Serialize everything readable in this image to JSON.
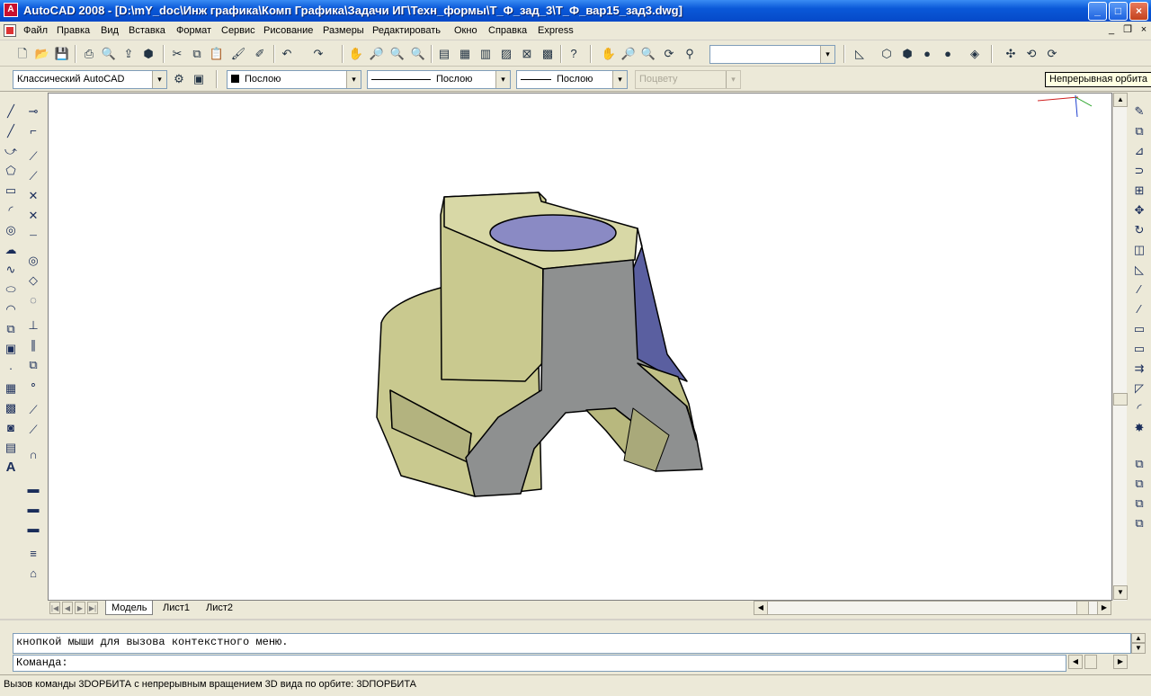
{
  "window": {
    "title": "AutoCAD 2008 - [D:\\mY_doc\\Инж графика\\Комп Графика\\Задачи ИГ\\Техн_формы\\Т_Ф_зад_3\\Т_Ф_вар15_зад3.dwg]",
    "app_icon_letter": "A",
    "minimize": "_",
    "maximize": "□",
    "close": "×"
  },
  "menu": {
    "items": [
      "Файл",
      "Правка",
      "Вид",
      "Вставка",
      "Формат",
      "Сервис",
      "Рисование",
      "Размеры",
      "Редактировать",
      "Окно",
      "Справка",
      "Express"
    ],
    "mdi_minimize": "_",
    "mdi_restore": "❐",
    "mdi_close": "×"
  },
  "toolbar_properties": {
    "workspace": "Классический AutoCAD",
    "layer_color": "Послою",
    "linetype": "Послою",
    "lineweight": "Послою",
    "plotstyle": "Поцвету",
    "dropdown_arrow": "▾"
  },
  "tooltip": "Непрерывная орбита",
  "layout_tabs": {
    "items": [
      "Модель",
      "Лист1",
      "Лист2"
    ],
    "active": "Модель",
    "nav_first": "|◀",
    "nav_prev": "◀",
    "nav_next": "▶",
    "nav_last": "▶|"
  },
  "scroll": {
    "up": "▲",
    "down": "▼",
    "left": "◀",
    "right": "▶"
  },
  "command": {
    "history": "кнопкой мыши для вызова контекстного меню.",
    "prompt": "Команда:"
  },
  "status": {
    "text": "Вызов команды 3DОРБИТА с непрерывным вращением 3D вида по орбите:  3DПОРБИТА"
  },
  "icons": {
    "left_draw": [
      "line-icon",
      "construction-line-icon",
      "polyline-icon",
      "polygon-icon",
      "rectangle-icon",
      "arc-icon",
      "circle-icon",
      "revcloud-icon",
      "spline-icon",
      "ellipse-icon",
      "ellipse-arc-icon",
      "insert-block-icon",
      "make-block-icon",
      "point-icon",
      "hatch-icon",
      "gradient-icon",
      "region-icon",
      "table-icon",
      "mtext-icon"
    ],
    "left_draw_glyphs": [
      "╱",
      "╱",
      "⤻",
      "⬠",
      "▭",
      "◜",
      "◎",
      "☁",
      "∿",
      "⬭",
      "◠",
      "⧉",
      "▣",
      "·",
      "▦",
      "▩",
      "◙",
      "▤",
      "A"
    ],
    "left_osnap_glyphs": [
      "⊸",
      "⌐",
      "⟋",
      "⟋",
      "✕",
      "✕",
      "┈",
      "◎",
      "◇",
      "◌",
      "⊥",
      "∥",
      "⧉",
      "∘",
      "⟋",
      "⟋",
      "∩",
      "▬",
      "▬",
      "▬",
      "≡",
      "⌂"
    ],
    "left_osnap": [
      "temp-track-icon",
      "snap-from-icon",
      "snap-endpoint-icon",
      "snap-midpoint-icon",
      "snap-intersection-icon",
      "snap-apparent-icon",
      "snap-extension-icon",
      "snap-center-icon",
      "snap-quadrant-icon",
      "snap-tangent-icon",
      "snap-perpendicular-icon",
      "snap-parallel-icon",
      "snap-insert-icon",
      "snap-node-icon",
      "snap-nearest-icon",
      "snap-none-icon",
      "osnap-settings-icon",
      "dim-linear-icon",
      "dim-aligned-icon",
      "dim-arc-icon",
      "dim-baseline-icon",
      "qdim-icon"
    ],
    "right_modify": [
      "erase-icon",
      "copy-icon",
      "mirror-icon",
      "offset-icon",
      "array-icon",
      "move-icon",
      "rotate-icon",
      "scale-icon",
      "stretch-icon",
      "trim-icon",
      "extend-icon",
      "break-at-point-icon",
      "break-icon",
      "join-icon",
      "chamfer-icon",
      "fillet-icon",
      "explode-icon",
      "draworder-front-icon",
      "draworder-back-icon",
      "draworder-above-icon",
      "draworder-under-icon"
    ],
    "right_modify_glyphs": [
      "✎",
      "⧉",
      "⊿",
      "⊃",
      "⊞",
      "✥",
      "↻",
      "◫",
      "◺",
      "⁄",
      "⁄",
      "▭",
      "▭",
      "⇉",
      "◸",
      "◜",
      "✸",
      "⧉",
      "⧉",
      "⧉",
      "⧉"
    ]
  },
  "colors": {
    "title_blue": "#0549c8",
    "ui_face": "#ece9d8",
    "model_face_light": "#c9c98f",
    "model_face_dark": "#8e9090",
    "model_face_blue": "#5a5fa0"
  }
}
